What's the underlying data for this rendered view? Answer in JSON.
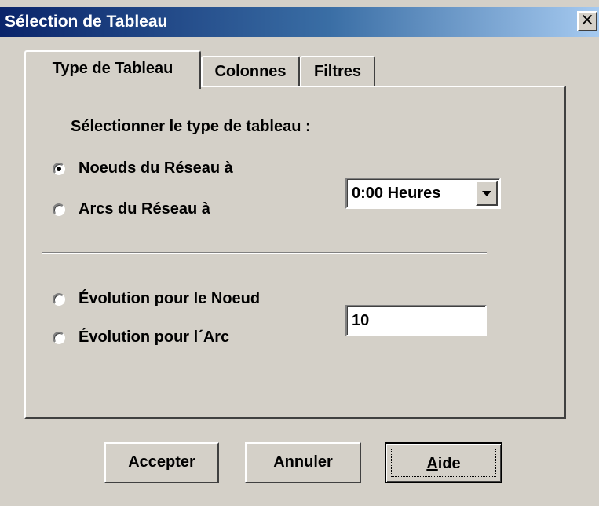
{
  "window": {
    "title": "Sélection de Tableau",
    "close_glyph": "×"
  },
  "tabs": [
    {
      "label": "Type de Tableau",
      "active": true
    },
    {
      "label": "Colonnes",
      "active": false
    },
    {
      "label": "Filtres",
      "active": false
    }
  ],
  "panel": {
    "heading": "Sélectionner le type de tableau :",
    "radios": [
      {
        "label": "Noeuds du Réseau à",
        "checked": true
      },
      {
        "label": "Arcs du Réseau à",
        "checked": false
      },
      {
        "label": "Évolution pour le Noeud",
        "checked": false
      },
      {
        "label": "Évolution pour l´Arc",
        "checked": false
      }
    ],
    "time_select": {
      "value": "0:00 Heures"
    },
    "id_input": {
      "value": "10"
    }
  },
  "buttons": {
    "accept": "Accepter",
    "cancel": "Annuler",
    "help_mnemonic": "A",
    "help_rest": "ide"
  },
  "icons": {
    "close": "close-icon",
    "dropdown": "chevron-down-icon"
  },
  "colors": {
    "dialog_face": "#d4d0c8",
    "titlebar_start": "#0a246a",
    "titlebar_end": "#a6caf0"
  }
}
